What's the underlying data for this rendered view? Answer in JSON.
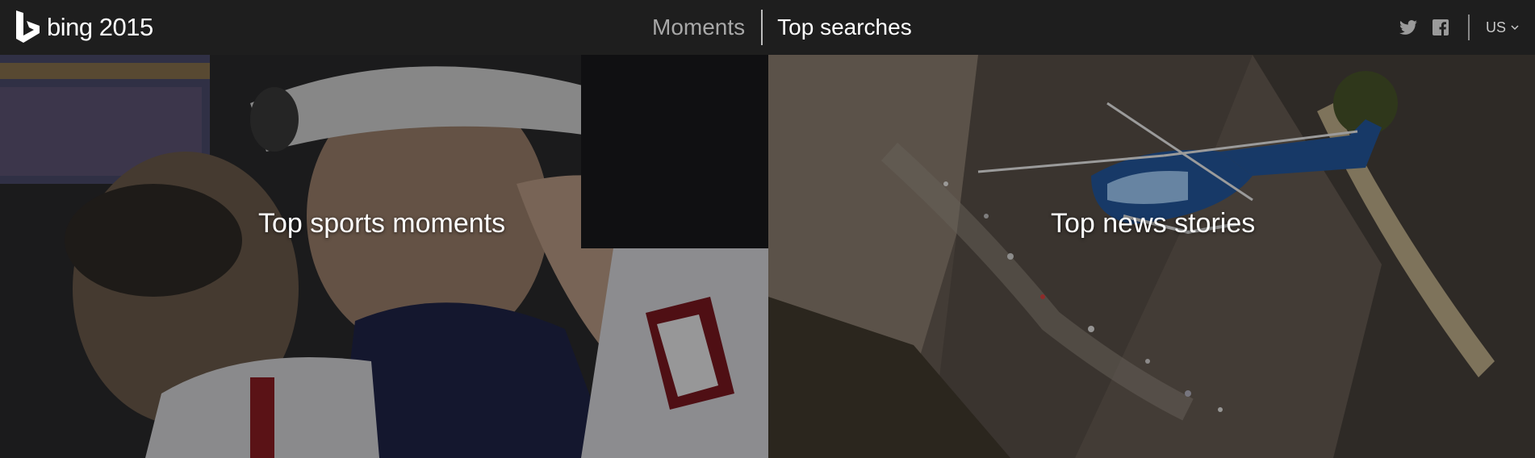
{
  "header": {
    "logo_text": "bing 2015",
    "nav": {
      "moments": "Moments",
      "top_searches": "Top searches"
    },
    "social": [
      "twitter-icon",
      "facebook-icon"
    ],
    "region": "US"
  },
  "tiles": [
    {
      "caption": "Top sports moments"
    },
    {
      "caption": "Top news stories"
    }
  ],
  "colors": {
    "topbar": "#1e1e1e",
    "nav_inactive": "#a8a8a8",
    "nav_active": "#ffffff"
  }
}
